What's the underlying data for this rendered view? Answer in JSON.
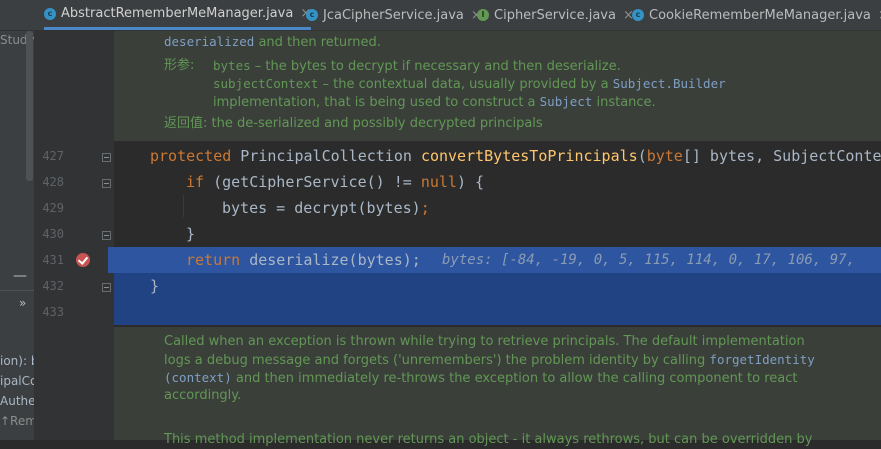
{
  "tabs": [
    {
      "label": "AbstractRememberMeManager.java",
      "kind": "class",
      "active": true
    },
    {
      "label": "JcaCipherService.java",
      "kind": "class",
      "active": false
    },
    {
      "label": "CipherService.java",
      "kind": "interface",
      "active": false
    },
    {
      "label": "CookieRememberMeManager.java",
      "kind": "class",
      "active": false
    }
  ],
  "tab_close_glyph": "×",
  "left_panel": {
    "top_text": "Study_",
    "collapse_glyph": "—",
    "expand_glyph": "»",
    "lines": [
      "ion): b",
      "ipalCo",
      "Auther",
      "↑Rem"
    ]
  },
  "doc_top": {
    "line1_code": "deserialized",
    "line1_text": "and then returned.",
    "params_label": "形参:",
    "param1_name": "bytes",
    "param1_text": " – the bytes to decrypt if necessary and then deserialize.",
    "param2_name": "subjectContext",
    "param2_text": " – the contextual data, usually provided by a ",
    "param2_code": "Subject.Builder",
    "param2_text2": "implementation, that is being used to construct a ",
    "param2_code2": "Subject",
    "param2_text3": " instance.",
    "returns_label": "返回值:",
    "returns_text": "the de-serialized and possibly decrypted principals"
  },
  "line_numbers": [
    "427",
    "428",
    "429",
    "430",
    "431",
    "432",
    "433"
  ],
  "code": {
    "l427_kw": "protected",
    "l427_type": " PrincipalCollection ",
    "l427_fn": "convertBytesToPrincipals",
    "l427_p1": "(",
    "l427_kw2": "byte",
    "l427_rest": "[] bytes, SubjectConte",
    "l428_kw": "if",
    "l428_a": " (getCipherService() != ",
    "l428_kw2": "null",
    "l428_b": ") {",
    "l429": "bytes = decrypt(bytes)",
    "l429_semi": ";",
    "l430": "}",
    "l431_kw": "return",
    "l431_rest": " deserialize(bytes);",
    "l431_inline": "bytes: [-84, -19, 0, 5, 115, 114, 0, 17, 106, 97,",
    "l432": "}"
  },
  "doc_bottom": {
    "line1": "Called when an exception is thrown while trying to retrieve principals. The default implementation",
    "line2a": "logs a debug message and forgets ('unremembers') the problem identity by calling ",
    "line2_code": "forgetIdentity",
    "line3_code": "(context)",
    "line3b": " and then immediately re-throws the exception to allow the calling component to react",
    "line4": "accordingly.",
    "line5": "This method implementation never returns an object - it always rethrows, but can be overridden by"
  }
}
